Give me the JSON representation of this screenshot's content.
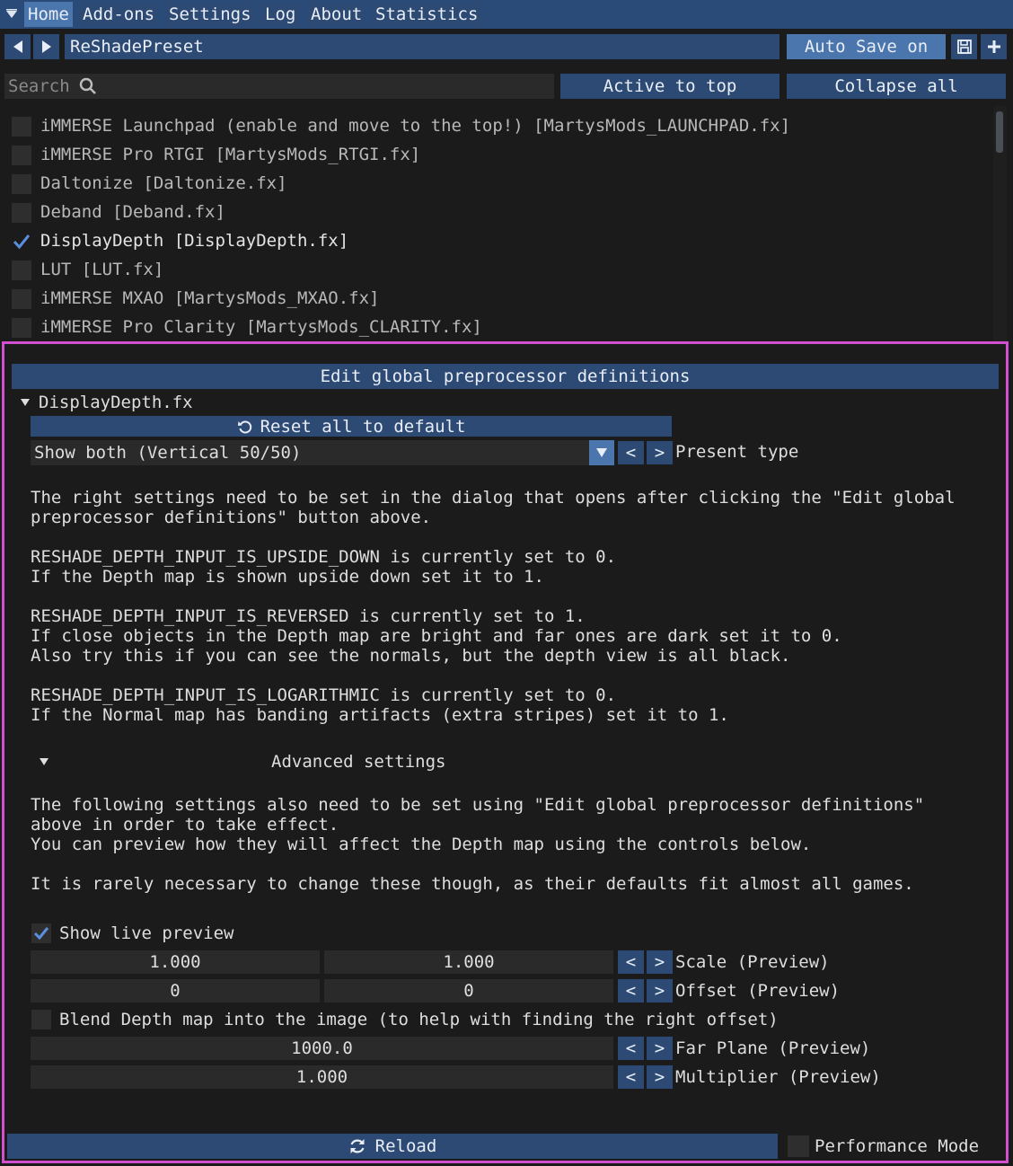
{
  "tabs": [
    "Home",
    "Add-ons",
    "Settings",
    "Log",
    "About",
    "Statistics"
  ],
  "preset": {
    "name": "ReShadePreset",
    "auto_save_label": "Auto Save on"
  },
  "toolbar": {
    "search_placeholder": "Search",
    "active_to_top": "Active to top",
    "collapse_all": "Collapse all"
  },
  "effects": [
    {
      "label": "iMMERSE Launchpad (enable and move to the top!) [MartysMods_LAUNCHPAD.fx]",
      "enabled": false
    },
    {
      "label": "iMMERSE Pro RTGI [MartysMods_RTGI.fx]",
      "enabled": false
    },
    {
      "label": "Daltonize [Daltonize.fx]",
      "enabled": false
    },
    {
      "label": "Deband [Deband.fx]",
      "enabled": false
    },
    {
      "label": "DisplayDepth [DisplayDepth.fx]",
      "enabled": true
    },
    {
      "label": "LUT [LUT.fx]",
      "enabled": false
    },
    {
      "label": "iMMERSE MXAO [MartysMods_MXAO.fx]",
      "enabled": false
    },
    {
      "label": "iMMERSE Pro Clarity [MartysMods_CLARITY.fx]",
      "enabled": false
    }
  ],
  "panel": {
    "edit_global_label": "Edit global preprocessor definitions",
    "effect_file": "DisplayDepth.fx",
    "reset_label": "Reset all to default",
    "present_type": {
      "value": "Show both (Vertical 50/50)",
      "label": "Present type"
    },
    "info": {
      "p1a": "The right settings need to be set in the dialog that opens after clicking the \"Edit global",
      "p1b": "preprocessor definitions\" button above.",
      "p2a": "RESHADE_DEPTH_INPUT_IS_UPSIDE_DOWN is currently set to 0.",
      "p2b": "If the Depth map is shown upside down set it to 1.",
      "p3a": "RESHADE_DEPTH_INPUT_IS_REVERSED is currently set to 1.",
      "p3b": "If close objects in the Depth map are bright and far ones are dark set it to 0.",
      "p3c": "Also try this if you can see the normals, but the depth view is all black.",
      "p4a": "RESHADE_DEPTH_INPUT_IS_LOGARITHMIC is currently set to 0.",
      "p4b": "If the Normal map has banding artifacts (extra stripes) set it to 1."
    },
    "advanced_label": "Advanced settings",
    "advanced_info": {
      "a1": "The following settings also need to be set using \"Edit global preprocessor definitions\"",
      "a2": "above in order to take effect.",
      "a3": "You can preview how they will affect the Depth map using the controls below.",
      "a4": "It is rarely necessary to change these though, as their defaults fit almost all games."
    },
    "show_live_preview": {
      "label": "Show live preview",
      "checked": true
    },
    "scale": {
      "x": "1.000",
      "y": "1.000",
      "label": "Scale (Preview)"
    },
    "offset": {
      "x": "0",
      "y": "0",
      "label": "Offset (Preview)"
    },
    "blend": {
      "label": "Blend Depth map into the image (to help with finding the right offset)",
      "checked": false
    },
    "far_plane": {
      "value": "1000.0",
      "label": "Far Plane (Preview)"
    },
    "multiplier": {
      "value": "1.000",
      "label": "Multiplier (Preview)"
    }
  },
  "footer": {
    "reload_label": "Reload",
    "performance_mode_label": "Performance Mode"
  },
  "colors": {
    "accent": "#4a75ad",
    "tab_bar": "#2a4a77",
    "highlight_border": "#d24fcf",
    "background": "#1b1b1b"
  }
}
